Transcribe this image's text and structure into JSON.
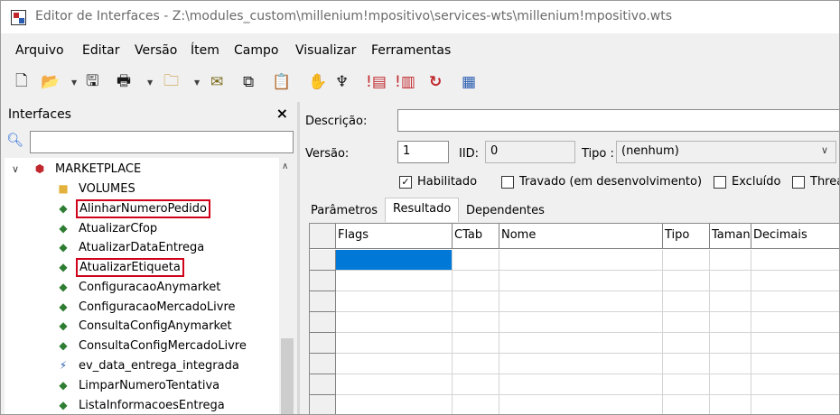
{
  "window": {
    "title": "Editor de Interfaces - Z:\\modules_custom\\millenium!mpositivo\\services-wts\\millenium!mpositivo.wts"
  },
  "menu": [
    "Arquivo",
    "Editar",
    "Versão",
    "Ítem",
    "Campo",
    "Visualizar",
    "Ferramentas"
  ],
  "toolbar": {
    "icons": [
      "new-document-icon",
      "open-folder-icon",
      "save-icon",
      "print-icon",
      "new-folder-icon",
      "open-icon",
      "copy-icon",
      "paste-icon",
      "execute-icon",
      "debug-icon",
      "field-add-icon",
      "field-edit-icon",
      "refresh-icon",
      "grid-icon"
    ]
  },
  "interfaces_panel": {
    "title": "Interfaces",
    "close_symbol": "×",
    "search_placeholder": "",
    "tree": [
      {
        "label": "MARKETPLACE",
        "icon": "package-folder-icon",
        "expanded": true
      },
      {
        "label": "VOLUMES",
        "icon": "folder-icon"
      },
      {
        "label": "AlinharNumeroPedido",
        "icon": "method-icon",
        "highlighted": true
      },
      {
        "label": "AtualizarCfop",
        "icon": "method-icon"
      },
      {
        "label": "AtualizarDataEntrega",
        "icon": "method-icon"
      },
      {
        "label": "AtualizarEtiqueta",
        "icon": "method-icon",
        "highlighted": true
      },
      {
        "label": "ConfiguracaoAnymarket",
        "icon": "method-icon"
      },
      {
        "label": "ConfiguracaoMercadoLivre",
        "icon": "method-icon"
      },
      {
        "label": "ConsultaConfigAnymarket",
        "icon": "method-icon"
      },
      {
        "label": "ConsultaConfigMercadoLivre",
        "icon": "method-icon"
      },
      {
        "label": "ev_data_entrega_integrada",
        "icon": "event-icon"
      },
      {
        "label": "LimparNumeroTentativa",
        "icon": "method-icon"
      },
      {
        "label": "ListaInformacoesEntrega",
        "icon": "method-icon"
      }
    ]
  },
  "details": {
    "descricao_label": "Descrição:",
    "descricao_value": "",
    "versao_label": "Versão:",
    "versao_value": "1",
    "iid_label": "IID:",
    "iid_value": "0",
    "tipo_label": "Tipo :",
    "tipo_value": "(nenhum)",
    "checkboxes": [
      {
        "label": "Habilitado",
        "checked": true
      },
      {
        "label": "Travado (em desenvolvimento)",
        "checked": false
      },
      {
        "label": "Excluído",
        "checked": false
      },
      {
        "label": "Threa",
        "checked": false
      }
    ],
    "tabs": [
      "Parâmetros",
      "Resultado",
      "Dependentes"
    ],
    "active_tab": "Resultado",
    "grid_columns": [
      "Flags",
      "CTab",
      "Nome",
      "Tipo",
      "Taman",
      "Decimais"
    ]
  },
  "colors": {
    "highlight_border": "#d0021b",
    "selected_cell": "#0078d7",
    "method_icon": "#2e7d32"
  }
}
